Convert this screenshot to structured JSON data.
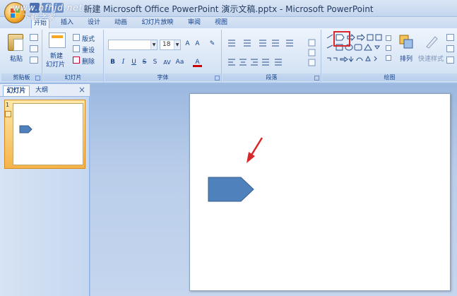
{
  "window": {
    "title": "新建 Microsoft Office PowerPoint 演示文稿.pptx - Microsoft PowerPoint",
    "watermark_line1": "www.nfhjd.net",
    "watermark_line2": "下载之家"
  },
  "tabs": [
    {
      "label": "开始",
      "active": true
    },
    {
      "label": "插入",
      "active": false
    },
    {
      "label": "设计",
      "active": false
    },
    {
      "label": "动画",
      "active": false
    },
    {
      "label": "幻灯片放映",
      "active": false
    },
    {
      "label": "审阅",
      "active": false
    },
    {
      "label": "视图",
      "active": false
    }
  ],
  "ribbon": {
    "clipboard": {
      "paste": "粘贴",
      "group_label": "剪贴板"
    },
    "slides": {
      "new_slide_line1": "新建",
      "new_slide_line2": "幻灯片",
      "layout": "版式",
      "reset": "重设",
      "delete": "删除",
      "group_label": "幻灯片"
    },
    "font": {
      "font_size": "18",
      "group_label": "字体"
    },
    "paragraph": {
      "group_label": "段落"
    },
    "drawing": {
      "arrange": "排列",
      "quick_styles": "快速样式",
      "group_label": "绘图"
    }
  },
  "left_pane": {
    "tab_slides": "幻灯片",
    "tab_outline": "大纲",
    "close": "×",
    "slide_number": "1"
  },
  "colors": {
    "shape_fill": "#4f81bd",
    "arrow_red": "#d9262a",
    "highlight_red": "#d9262a"
  }
}
